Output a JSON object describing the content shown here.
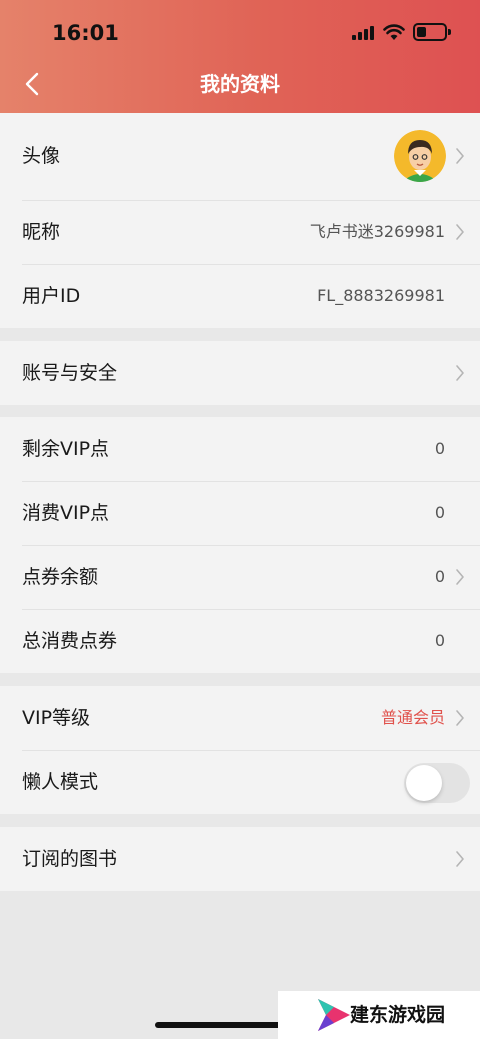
{
  "status_bar": {
    "time": "16:01"
  },
  "header": {
    "title": "我的资料"
  },
  "groups": [
    {
      "rows": [
        {
          "label": "头像"
        },
        {
          "label": "昵称",
          "value": "飞卢书迷3269981"
        },
        {
          "label": "用户ID",
          "value": "FL_8883269981"
        }
      ]
    },
    {
      "rows": [
        {
          "label": "账号与安全"
        }
      ]
    },
    {
      "rows": [
        {
          "label": "剩余VIP点",
          "value": "0"
        },
        {
          "label": "消费VIP点",
          "value": "0"
        },
        {
          "label": "点券余额",
          "value": "0"
        },
        {
          "label": "总消费点券",
          "value": "0"
        }
      ]
    },
    {
      "rows": [
        {
          "label": "VIP等级",
          "value": "普通会员"
        },
        {
          "label": "懒人模式",
          "toggle_on": false
        }
      ]
    },
    {
      "rows": [
        {
          "label": "订阅的图书"
        }
      ]
    }
  ],
  "colors": {
    "accent": "#de5152",
    "vip_value": "#e0524c",
    "header_start": "#e5826a"
  },
  "watermark": {
    "text": "建东游戏园"
  }
}
